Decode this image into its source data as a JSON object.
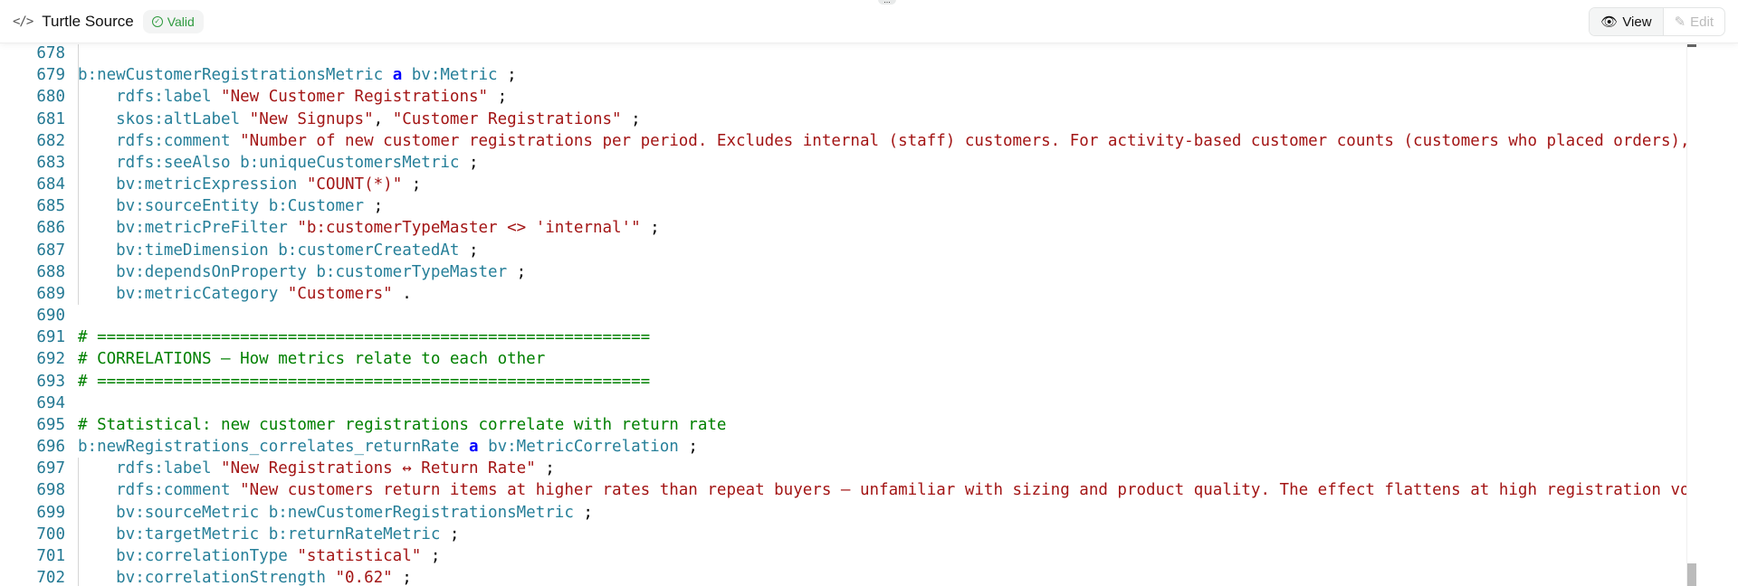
{
  "header": {
    "icon": "code-icon",
    "title": "Turtle Source",
    "status": "Valid",
    "status_color": "#2e9a3e",
    "grip": "...",
    "view_label": "View",
    "edit_label": "Edit"
  },
  "lines": [
    {
      "n": "678",
      "tokens": []
    },
    {
      "n": "679",
      "tokens": [
        [
          "p",
          "b:newCustomerRegistrationsMetric "
        ],
        [
          "k",
          "a"
        ],
        [
          "p",
          " bv:Metric"
        ],
        [
          "o",
          " ;"
        ]
      ]
    },
    {
      "n": "680",
      "tokens": [
        [
          "p",
          "    rdfs:label "
        ],
        [
          "s",
          "\"New Customer Registrations\""
        ],
        [
          "o",
          " ;"
        ]
      ]
    },
    {
      "n": "681",
      "tokens": [
        [
          "p",
          "    skos:altLabel "
        ],
        [
          "s",
          "\"New Signups\""
        ],
        [
          "o",
          ", "
        ],
        [
          "s",
          "\"Customer Registrations\""
        ],
        [
          "o",
          " ;"
        ]
      ]
    },
    {
      "n": "682",
      "tokens": [
        [
          "p",
          "    rdfs:comment "
        ],
        [
          "s",
          "\"Number of new customer registrations per period. Excludes internal (staff) customers. For activity-based customer counts (customers who placed orders), see b:uniqueCus"
        ]
      ]
    },
    {
      "n": "683",
      "tokens": [
        [
          "p",
          "    rdfs:seeAlso b:uniqueCustomersMetric"
        ],
        [
          "o",
          " ;"
        ]
      ]
    },
    {
      "n": "684",
      "tokens": [
        [
          "p",
          "    bv:metricExpression "
        ],
        [
          "s",
          "\"COUNT(*)\""
        ],
        [
          "o",
          " ;"
        ]
      ]
    },
    {
      "n": "685",
      "tokens": [
        [
          "p",
          "    bv:sourceEntity b:Customer"
        ],
        [
          "o",
          " ;"
        ]
      ]
    },
    {
      "n": "686",
      "tokens": [
        [
          "p",
          "    bv:metricPreFilter "
        ],
        [
          "s",
          "\"b:customerTypeMaster <> 'internal'\""
        ],
        [
          "o",
          " ;"
        ]
      ]
    },
    {
      "n": "687",
      "tokens": [
        [
          "p",
          "    bv:timeDimension b:customerCreatedAt"
        ],
        [
          "o",
          " ;"
        ]
      ]
    },
    {
      "n": "688",
      "tokens": [
        [
          "p",
          "    bv:dependsOnProperty b:customerTypeMaster"
        ],
        [
          "o",
          " ;"
        ]
      ]
    },
    {
      "n": "689",
      "tokens": [
        [
          "p",
          "    bv:metricCategory "
        ],
        [
          "s",
          "\"Customers\""
        ],
        [
          "o",
          " ."
        ]
      ]
    },
    {
      "n": "690",
      "tokens": []
    },
    {
      "n": "691",
      "tokens": [
        [
          "c",
          "# =========================================================="
        ]
      ]
    },
    {
      "n": "692",
      "tokens": [
        [
          "c",
          "# CORRELATIONS — How metrics relate to each other"
        ]
      ]
    },
    {
      "n": "693",
      "tokens": [
        [
          "c",
          "# =========================================================="
        ]
      ]
    },
    {
      "n": "694",
      "tokens": []
    },
    {
      "n": "695",
      "tokens": [
        [
          "c",
          "# Statistical: new customer registrations correlate with return rate"
        ]
      ]
    },
    {
      "n": "696",
      "tokens": [
        [
          "p",
          "b:newRegistrations_correlates_returnRate "
        ],
        [
          "k",
          "a"
        ],
        [
          "p",
          " bv:MetricCorrelation"
        ],
        [
          "o",
          " ;"
        ]
      ]
    },
    {
      "n": "697",
      "tokens": [
        [
          "p",
          "    rdfs:label "
        ],
        [
          "s",
          "\"New Registrations ↔ Return Rate\""
        ],
        [
          "o",
          " ;"
        ]
      ]
    },
    {
      "n": "698",
      "tokens": [
        [
          "p",
          "    rdfs:comment "
        ],
        [
          "s",
          "\"New customers return items at higher rates than repeat buyers — unfamiliar with sizing and product quality. The effect flattens at high registration volumes.\""
        ],
        [
          "o",
          " ;"
        ]
      ]
    },
    {
      "n": "699",
      "tokens": [
        [
          "p",
          "    bv:sourceMetric b:newCustomerRegistrationsMetric"
        ],
        [
          "o",
          " ;"
        ]
      ]
    },
    {
      "n": "700",
      "tokens": [
        [
          "p",
          "    bv:targetMetric b:returnRateMetric"
        ],
        [
          "o",
          " ;"
        ]
      ]
    },
    {
      "n": "701",
      "tokens": [
        [
          "p",
          "    bv:correlationType "
        ],
        [
          "s",
          "\"statistical\""
        ],
        [
          "o",
          " ;"
        ]
      ]
    },
    {
      "n": "702",
      "tokens": [
        [
          "p",
          "    bv:correlationStrength "
        ],
        [
          "s",
          "\"0.62\""
        ],
        [
          "o",
          " ;"
        ]
      ]
    }
  ]
}
